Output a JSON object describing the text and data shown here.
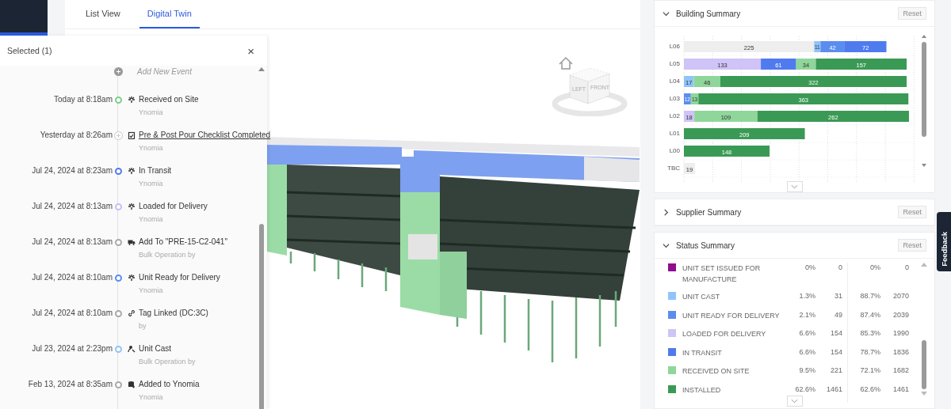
{
  "tabs": [
    {
      "label": "List View",
      "selected": false
    },
    {
      "label": "Digital Twin",
      "selected": true
    }
  ],
  "viewer": {
    "kind": "picture",
    "viewcube": [
      "LEFT",
      "FRONT"
    ]
  },
  "selected_panel": {
    "title": "Selected (1)",
    "close": "×",
    "add_event": "Add New Event",
    "events": [
      {
        "time": "Today at 8:18am",
        "color": "#7ccf8a",
        "kind": "status",
        "title": "Received on Site",
        "subtitle": "Ynomia"
      },
      {
        "time": "Yesterday at 8:26am",
        "color": "#c8c8c8",
        "kind": "checklist",
        "title": "Pre & Post Pour Checklist Completed",
        "subtitle": "Ynomia"
      },
      {
        "time": "Jul 24, 2024 at 8:23am",
        "color": "#4f7bef",
        "kind": "status",
        "title": "In Transit",
        "subtitle": "Ynomia"
      },
      {
        "time": "Jul 24, 2024 at 8:13am",
        "color": "#c9bdf5",
        "kind": "status",
        "title": "Loaded for Delivery",
        "subtitle": "Ynomia"
      },
      {
        "time": "Jul 24, 2024 at 8:13am",
        "color": "#a9a9a9",
        "kind": "truck",
        "title": "Add To \"PRE-15-C2-041\"",
        "subtitle": "Bulk Operation by"
      },
      {
        "time": "Jul 24, 2024 at 8:10am",
        "color": "#5b8def",
        "kind": "status",
        "title": "Unit Ready for Delivery",
        "subtitle": "Ynomia"
      },
      {
        "time": "Jul 24, 2024 at 8:10am",
        "color": "#a9a9a9",
        "kind": "link",
        "title": "Tag Linked (DC:3C)",
        "subtitle": "by"
      },
      {
        "time": "Jul 23, 2024 at 2:23pm",
        "color": "#90c4f9",
        "kind": "cast",
        "title": "Unit Cast",
        "subtitle": "Bulk Operation by"
      },
      {
        "time": "Feb 13, 2024 at 8:35am",
        "color": "#a9a9a9",
        "kind": "database",
        "title": "Added to Ynomia",
        "subtitle": "Ynomia"
      }
    ]
  },
  "building_summary": {
    "title": "Building Summary",
    "expanded": true,
    "reset": "Reset",
    "chart_data": {
      "type": "bar",
      "orientation": "horizontal",
      "stacked": true,
      "categories": [
        "L06",
        "L05",
        "L04",
        "L03",
        "L02",
        "L01",
        "L00",
        "TBC"
      ],
      "series": [
        {
          "color": "#eeeeee",
          "values": [
            225,
            null,
            null,
            null,
            null,
            null,
            null,
            19
          ]
        },
        {
          "color": "#90c4f9",
          "values": [
            11,
            null,
            17,
            null,
            null,
            null,
            null,
            null
          ]
        },
        {
          "color": "#5b8def",
          "values": [
            42,
            null,
            null,
            12,
            null,
            null,
            null,
            null
          ]
        },
        {
          "color": "#cfc3f7",
          "values": [
            null,
            133,
            null,
            null,
            18,
            null,
            null,
            null
          ]
        },
        {
          "color": "#4f7bef",
          "values": [
            72,
            61,
            null,
            null,
            null,
            null,
            null,
            null
          ]
        },
        {
          "color": "#8fd69a",
          "values": [
            null,
            34,
            46,
            13,
            109,
            null,
            null,
            null
          ]
        },
        {
          "color": "#3a9a55",
          "values": [
            null,
            157,
            322,
            363,
            262,
            209,
            148,
            null
          ]
        }
      ],
      "data_labels": true
    }
  },
  "supplier_summary": {
    "title": "Supplier Summary",
    "expanded": false,
    "reset": "Reset"
  },
  "status_summary": {
    "title": "Status Summary",
    "expanded": true,
    "reset": "Reset",
    "rows": [
      {
        "label": "UNIT SET ISSUED FOR MANUFACTURE",
        "color": "#8e0f8e",
        "values": [
          "0%",
          "0",
          "0%",
          "0"
        ]
      },
      {
        "label": "UNIT CAST",
        "color": "#90c4f9",
        "values": [
          "1.3%",
          "31",
          "88.7%",
          "2070"
        ]
      },
      {
        "label": "UNIT READY FOR DELIVERY",
        "color": "#5b8def",
        "values": [
          "2.1%",
          "49",
          "87.4%",
          "2039"
        ]
      },
      {
        "label": "LOADED FOR DELIVERY",
        "color": "#cfc3f7",
        "values": [
          "6.6%",
          "154",
          "85.3%",
          "1990"
        ]
      },
      {
        "label": "IN TRANSIT",
        "color": "#4f7bef",
        "values": [
          "6.6%",
          "154",
          "78.7%",
          "1836"
        ]
      },
      {
        "label": "RECEIVED ON SITE",
        "color": "#8fd69a",
        "values": [
          "9.5%",
          "221",
          "72.1%",
          "1682"
        ]
      },
      {
        "label": "INSTALLED",
        "color": "#3a9a55",
        "values": [
          "62.6%",
          "1461",
          "62.6%",
          "1461"
        ]
      }
    ]
  },
  "feedback": "Feedback"
}
